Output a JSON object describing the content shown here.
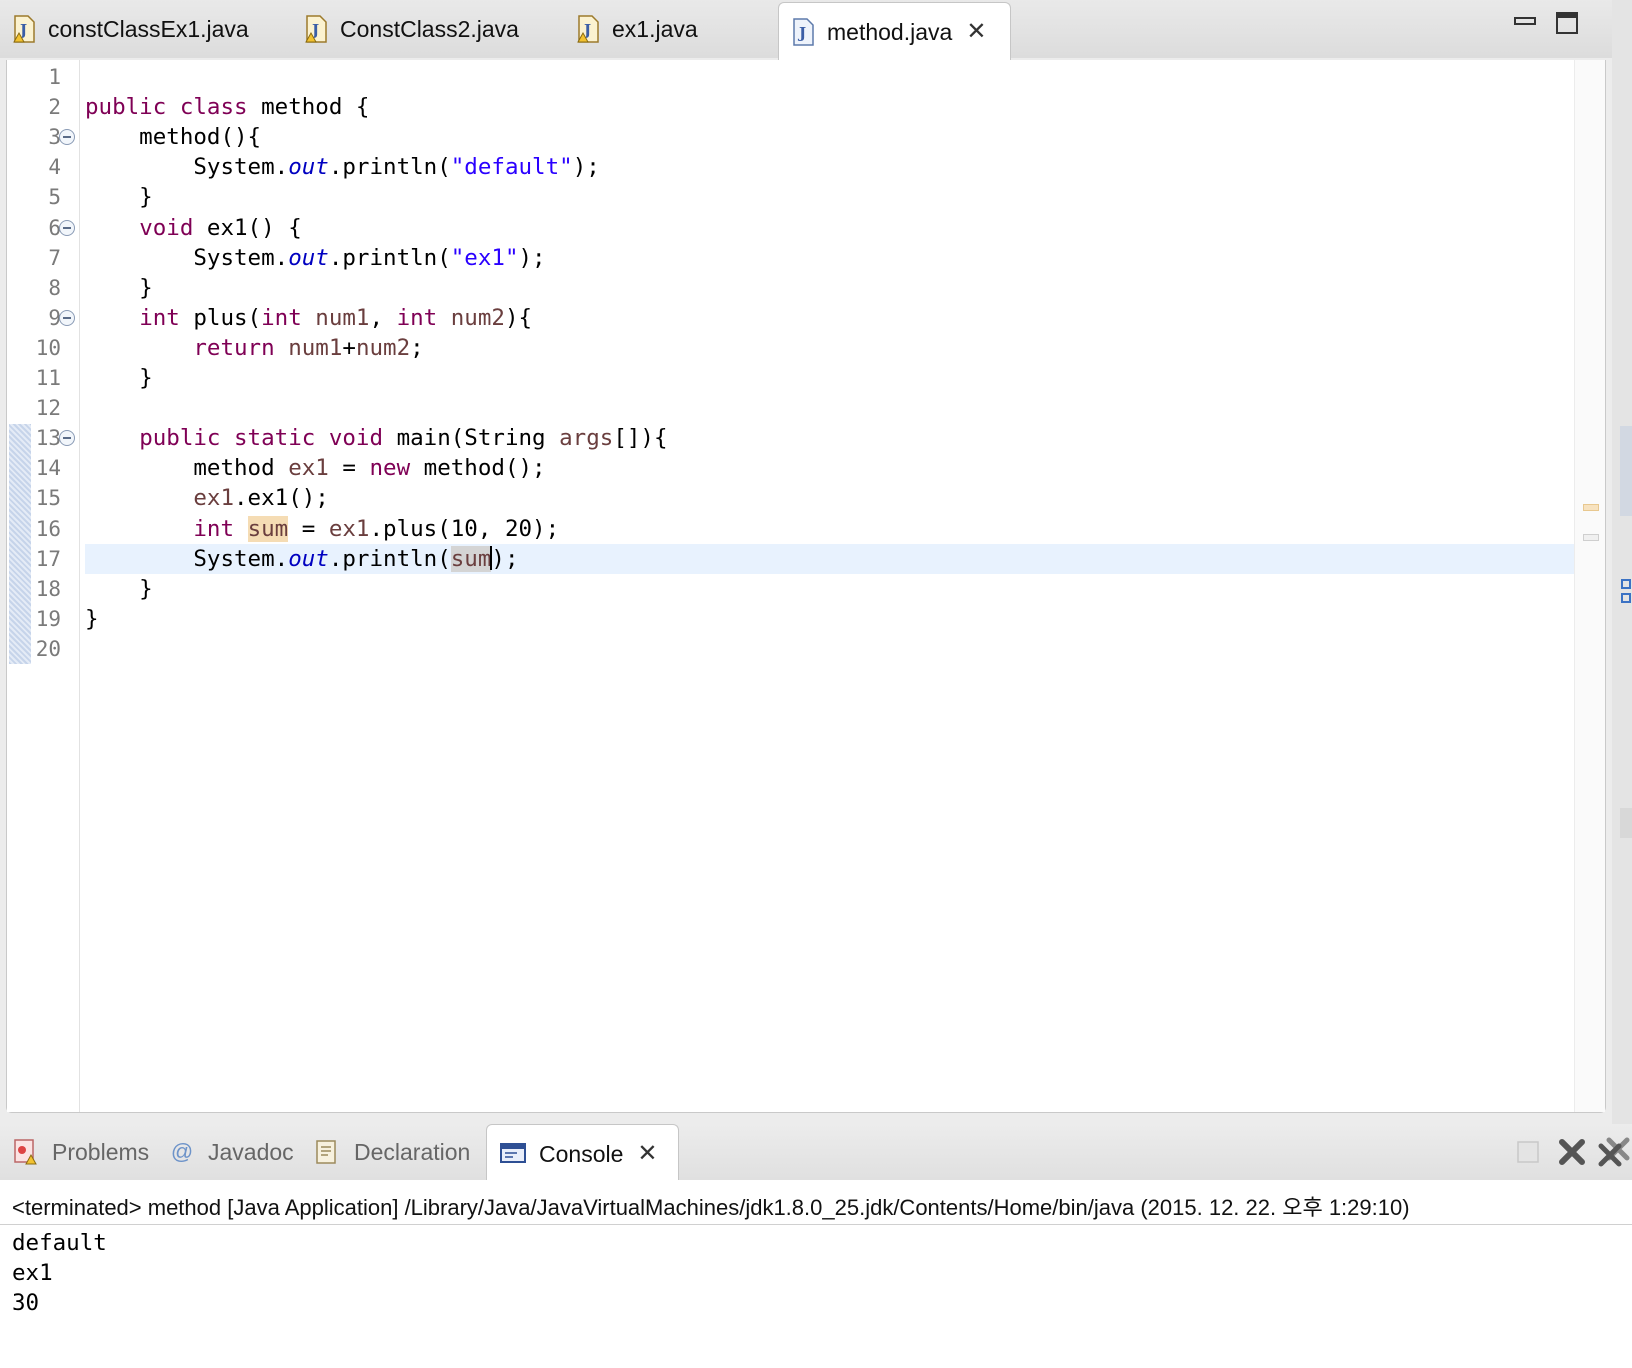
{
  "editor_tabs": [
    {
      "label": "constClassEx1.java",
      "icon": "java-file-warning-icon",
      "active": false
    },
    {
      "label": "ConstClass2.java",
      "icon": "java-file-warning-icon",
      "active": false
    },
    {
      "label": "ex1.java",
      "icon": "java-file-warning-icon",
      "active": false
    },
    {
      "label": "method.java",
      "icon": "java-file-icon",
      "active": true
    }
  ],
  "window_controls": [
    "minimize-icon",
    "maximize-icon"
  ],
  "editor": {
    "line_numbers": [
      "1",
      "2",
      "3",
      "4",
      "5",
      "6",
      "7",
      "8",
      "9",
      "10",
      "11",
      "12",
      "13",
      "14",
      "15",
      "16",
      "17",
      "18",
      "19",
      "20"
    ],
    "current_line": 17,
    "code_lines": [
      "",
      "public class method {",
      "    method(){",
      "        System.out.println(\"default\");",
      "    }",
      "    void ex1() {",
      "        System.out.println(\"ex1\");",
      "    }",
      "    int plus(int num1, int num2){",
      "        return num1+num2;",
      "    }",
      "",
      "    public static void main(String args[]){",
      "        method ex1 = new method();",
      "        ex1.ex1();",
      "        int sum = ex1.plus(10, 20);",
      "        System.out.println(sum);",
      "    }",
      "}",
      ""
    ]
  },
  "view_tabs": [
    {
      "label": "Problems",
      "icon": "problems-icon",
      "active": false
    },
    {
      "label": "Javadoc",
      "icon": "javadoc-at-icon",
      "active": false
    },
    {
      "label": "Declaration",
      "icon": "declaration-icon",
      "active": false
    },
    {
      "label": "Console",
      "icon": "console-icon",
      "active": true
    }
  ],
  "console": {
    "terminated_label": "<terminated> method [Java Application] /Library/Java/JavaVirtualMachines/jdk1.8.0_25.jdk/Contents/Home/bin/java (2015. 12. 22. 오후 1:29:10)",
    "output_lines": [
      "default",
      "ex1",
      "30"
    ]
  },
  "console_toolbar": [
    "terminate-icon",
    "remove-launch-icon",
    "remove-all-terminated-icon"
  ],
  "colors": {
    "keyword": "#7f0055",
    "string": "#2a00ff",
    "static_field": "#0000c0",
    "local_variable": "#6a3e3e",
    "current_line": "#e8f2fe",
    "occurrence": "#f5dcb4"
  }
}
